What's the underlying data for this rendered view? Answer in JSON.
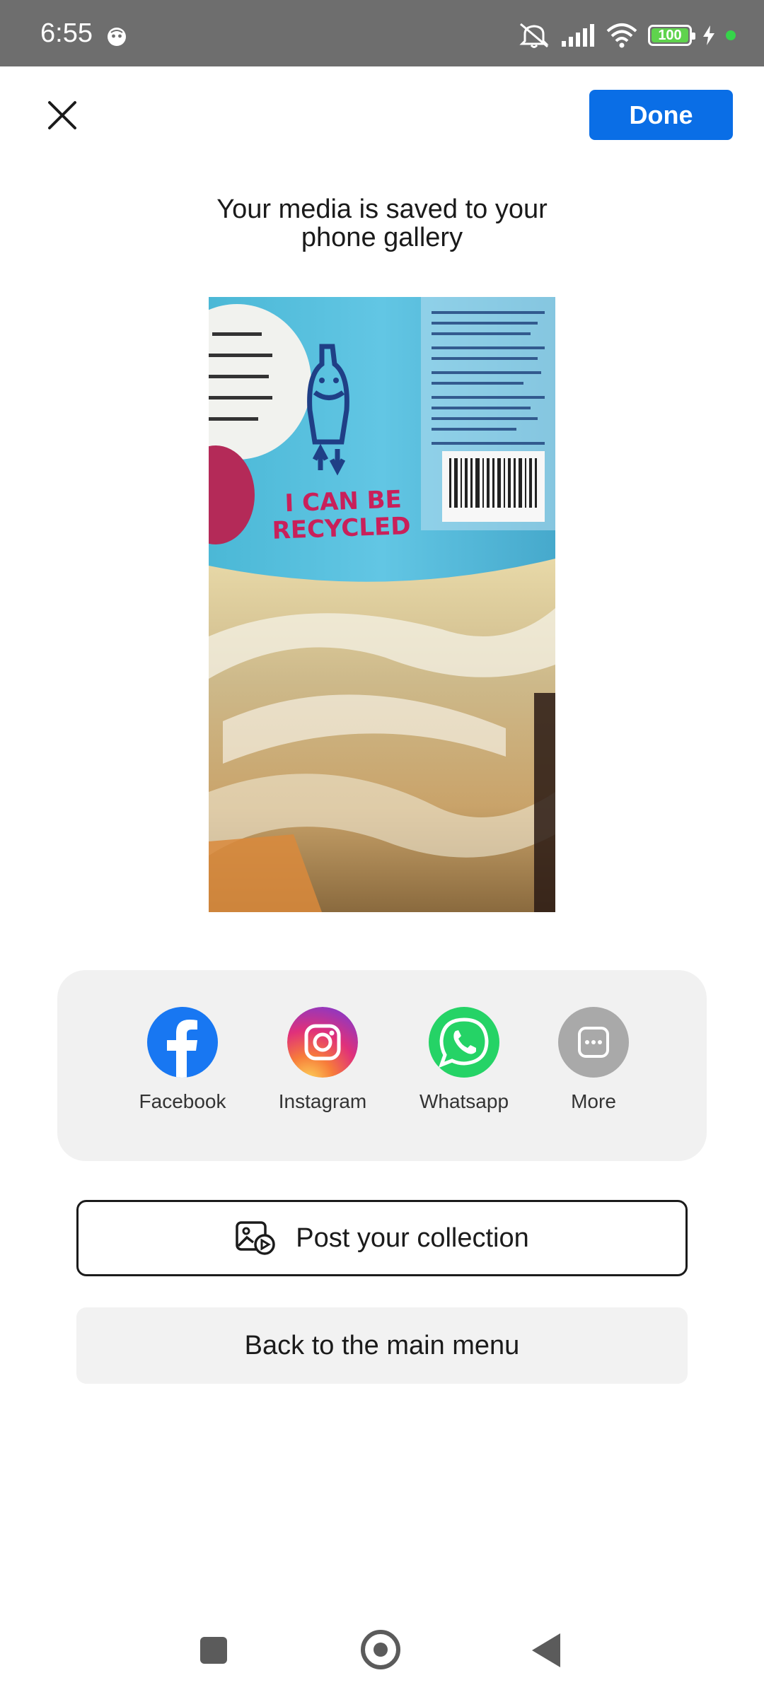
{
  "status_bar": {
    "time": "6:55",
    "battery_level": "100",
    "icons": [
      "face-icon",
      "mute-icon",
      "signal-icon",
      "wifi-icon",
      "battery-icon",
      "charging-icon",
      "green-dot-indicator"
    ]
  },
  "header": {
    "close_icon": "close-icon",
    "done_label": "Done"
  },
  "headline": {
    "line1": "Your media is saved to your",
    "line2": "phone gallery"
  },
  "media": {
    "label_text": "I CAN BE RECYCLED"
  },
  "share": {
    "items": [
      {
        "label": "Facebook",
        "icon": "facebook-icon",
        "color": "#1877f2"
      },
      {
        "label": "Instagram",
        "icon": "instagram-icon",
        "color": "#d6249f"
      },
      {
        "label": "Whatsapp",
        "icon": "whatsapp-icon",
        "color": "#25d366"
      },
      {
        "label": "More",
        "icon": "more-icon",
        "color": "#a9a9a9"
      }
    ]
  },
  "actions": {
    "post_label": "Post your collection",
    "back_label": "Back to the main menu"
  },
  "colors": {
    "accent": "#0a6ee6",
    "status_bar": "#6e6e6e",
    "card_bg": "#f1f1f1"
  }
}
